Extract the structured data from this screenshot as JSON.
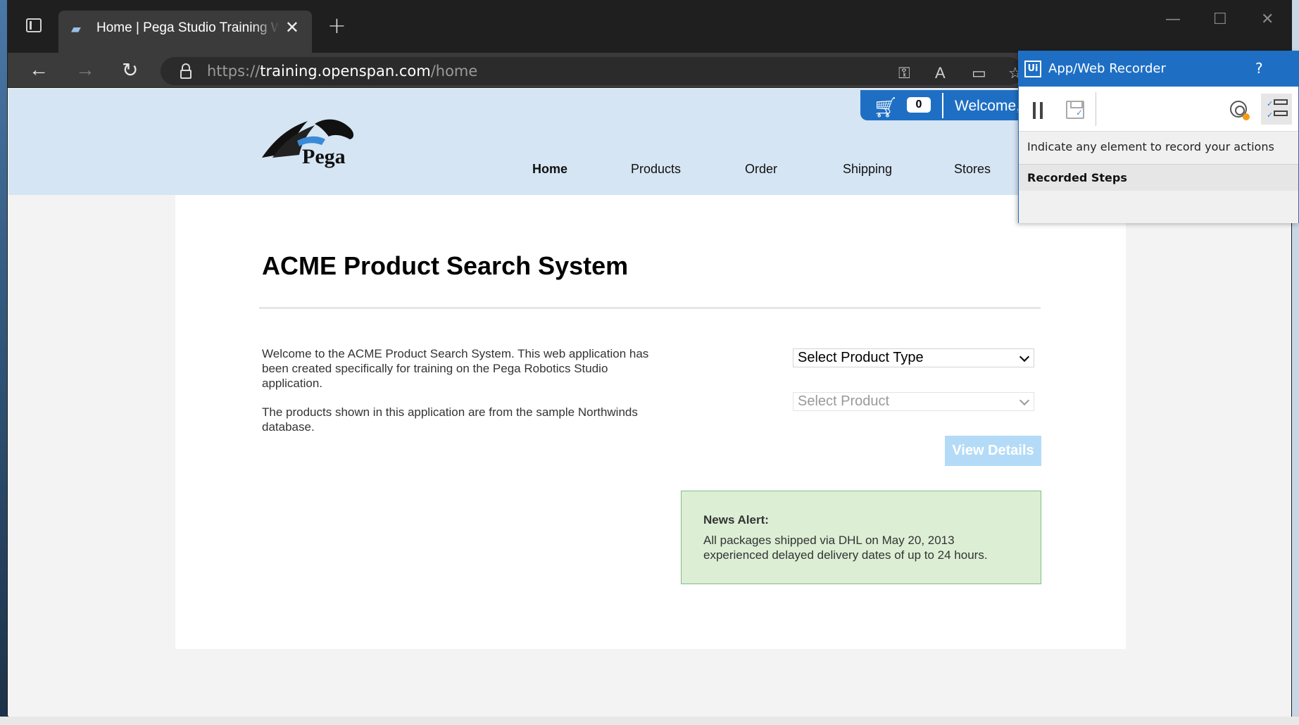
{
  "browser": {
    "tab_title": "Home | Pega Studio Training Web",
    "tab_close": "✕",
    "new_tab": "+",
    "url_scheme": "https://",
    "url_host": "training.openspan.com",
    "url_path": "/home",
    "back": "←",
    "forward": "→",
    "refresh": "↻",
    "minimize": "—",
    "maximize": "☐",
    "close": "✕"
  },
  "site": {
    "logo_text": "Pega",
    "cart_count": "0",
    "welcome": "Welcome,",
    "nav": [
      {
        "label": "Home"
      },
      {
        "label": "Products"
      },
      {
        "label": "Order"
      },
      {
        "label": "Shipping"
      },
      {
        "label": "Stores"
      }
    ]
  },
  "main": {
    "title": "ACME Product Search System",
    "intro_p1": "Welcome to the ACME Product Search System. This web application has been created specifically for training on the Pega Robotics Studio application.",
    "intro_p2": "The products shown in this application are from the sample Northwinds database.",
    "select_type": "Select Product Type",
    "select_product": "Select Product",
    "view_details": "View Details",
    "news_title": "News Alert:",
    "news_body": "All packages shipped via DHL on May 20, 2013 experienced delayed delivery dates of up to 24 hours."
  },
  "recorder": {
    "logo": "Ui",
    "title": "App/Web Recorder",
    "help": "?",
    "hint": "Indicate any element to record your actions",
    "steps_header": "Recorded Steps"
  },
  "colors": {
    "accent": "#1e6fc4",
    "header_bg": "#d5e5f3",
    "news_bg": "#dcefd5",
    "button_disabled": "#b3dbf7"
  }
}
